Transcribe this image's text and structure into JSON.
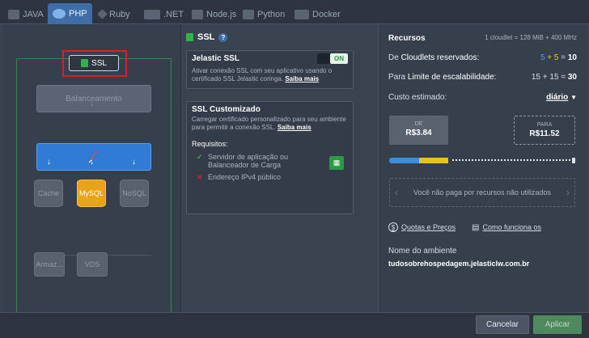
{
  "tabs": [
    {
      "label": "JAVA",
      "icon": "java-icon",
      "active": false
    },
    {
      "label": "PHP",
      "icon": "php-icon",
      "active": true
    },
    {
      "label": "Ruby",
      "icon": "ruby-icon",
      "active": false
    },
    {
      "label": ".NET",
      "icon": "dotnet-icon",
      "active": false
    },
    {
      "label": "Node.js",
      "icon": "nodejs-icon",
      "active": false
    },
    {
      "label": "Python",
      "icon": "python-icon",
      "active": false
    },
    {
      "label": "Docker",
      "icon": "docker-icon",
      "active": false
    }
  ],
  "topology": {
    "ssl_label": "SSL",
    "balancer_label": "Balanceamento",
    "cache_label": "Cache",
    "mysql_label": "MySQL",
    "nosql_label": "NoSQL",
    "storage_label": "Armaz...",
    "vds_label": "VDS"
  },
  "ssl": {
    "heading": "SSL",
    "jelastic": {
      "title": "Jelastic SSL",
      "toggle": "ON",
      "desc": "Ativar conexão SSL com seu aplicativo usando o certificado SSL Jelastic coringa.",
      "more": "Saiba mais"
    },
    "custom": {
      "title": "SSL Customizado",
      "desc": "Carregar certificado personalizado para seu ambiente para permitir a conexão SSL.",
      "more": "Saiba mais",
      "req_title": "Requisitos:",
      "req1": "Servidor de aplicação ou Balanceador de Carga",
      "req2": "Endereço IPv4 público"
    }
  },
  "resources": {
    "title": "Recursos",
    "cloudlet_info": "1 cloudlet = 128 MiB + 400 MHz",
    "reserved_prefix": "De",
    "reserved_label": "Cloudlets reservados:",
    "reserved_a": "5",
    "reserved_plus": "+",
    "reserved_b": "5",
    "reserved_eq": "=",
    "reserved_total": "10",
    "scaling_prefix": "Para",
    "scaling_label": "Limite de escalabilidade:",
    "scaling_value": "15 + 15 =",
    "scaling_total": "30",
    "cost_label": "Custo estimado:",
    "cost_period": "diário",
    "from_label": "DE",
    "from_price": "R$3.84",
    "to_label": "PARA",
    "to_price": "R$11.52",
    "free_text": "Você não paga por recursos não utilizados",
    "quotas_link": "Quotas e Preços",
    "how_link": "Como funciona os",
    "env_name_label": "Nome do ambiente",
    "env_name_value": "tudosobrehospedagem.jelasticlw.com.br"
  },
  "footer": {
    "cancel": "Cancelar",
    "apply": "Aplicar"
  },
  "colors": {
    "accent": "#3f6da8",
    "apply": "#4f8a5f",
    "ssl_green": "#32b24a",
    "highlight_red": "#d6202a"
  }
}
